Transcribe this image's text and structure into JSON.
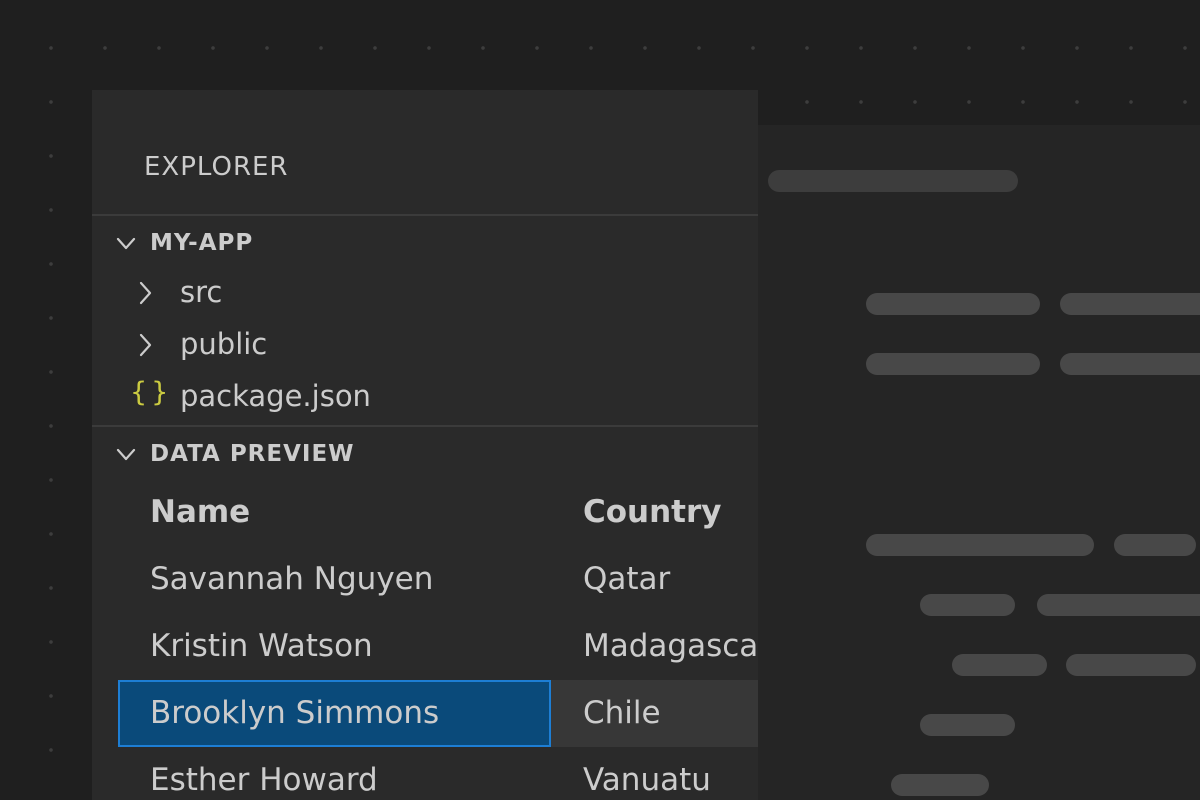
{
  "sidebar": {
    "title": "EXPLORER",
    "project": {
      "label": "MY-APP",
      "items": [
        {
          "label": "src",
          "icon": "chevron-right-icon"
        },
        {
          "label": "public",
          "icon": "chevron-right-icon"
        },
        {
          "label": "package.json",
          "icon": "json-braces-icon",
          "icon_glyph": "{}"
        }
      ]
    },
    "data_preview": {
      "label": "DATA PREVIEW",
      "columns": [
        "Name",
        "Country"
      ],
      "rows": [
        {
          "name": "Savannah Nguyen",
          "country": "Qatar"
        },
        {
          "name": "Kristin Watson",
          "country": "Madagascar"
        },
        {
          "name": "Brooklyn Simmons",
          "country": "Chile"
        },
        {
          "name": "Esther Howard",
          "country": "Vanuatu"
        }
      ],
      "selected_row": 2
    }
  },
  "colors": {
    "background": "#1f1f1f",
    "sidebar": "#2a2a2a",
    "editor": "#252525",
    "text": "#cccccc",
    "json_icon": "#cbcb41",
    "selection_fill": "#0a4a7a",
    "selection_border": "#1d7ed4"
  }
}
